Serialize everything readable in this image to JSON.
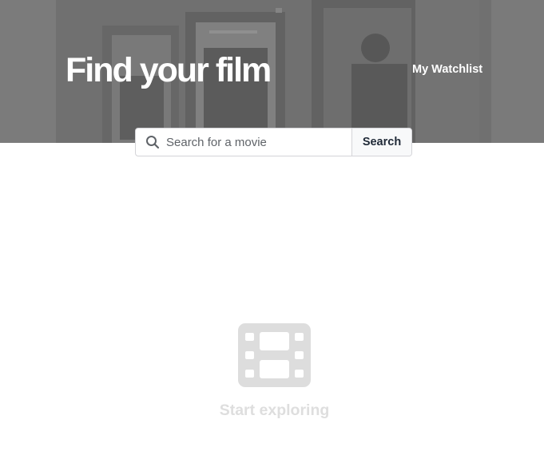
{
  "header": {
    "title": "Find your film",
    "watchlist_label": "My Watchlist"
  },
  "search": {
    "placeholder": "Search for a movie",
    "value": "",
    "button_label": "Search",
    "icon": "search-icon"
  },
  "empty_state": {
    "icon": "film-icon",
    "message": "Start exploring"
  },
  "colors": {
    "hero_overlay": "#7a7a7a",
    "title_text": "#ffffff",
    "search_button_text": "#1f2937",
    "empty_icon": "#dddddd",
    "empty_text": "#dedede"
  }
}
